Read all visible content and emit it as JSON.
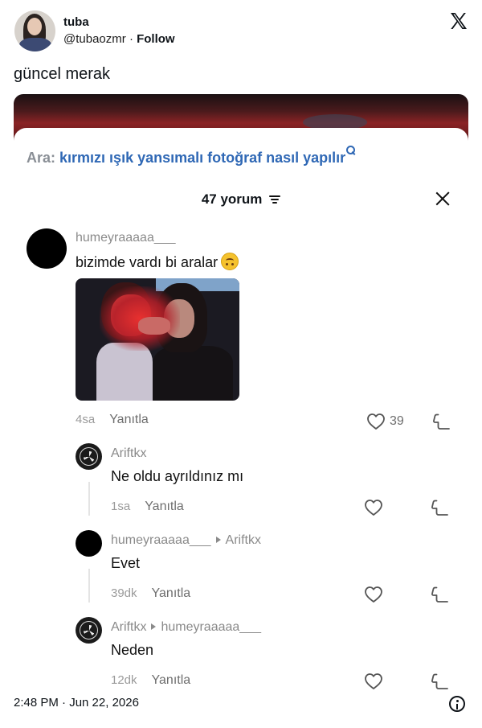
{
  "tweet": {
    "author_name": "tuba",
    "handle": "@tubaozmr",
    "separator": "·",
    "follow_label": "Follow",
    "text": "güncel merak",
    "timestamp": "2:48 PM · Jun 22, 2026"
  },
  "screenshot": {
    "search_prefix": "Ara:",
    "search_query": "kırmızı ışık yansımalı fotoğraf nasıl yapılır",
    "comments_count_label": "47 yorum",
    "comments": [
      {
        "user": "humeyraaaaa___",
        "text": "bizimde vardı bi aralar",
        "emoji": "upside-down-face",
        "time": "4sa",
        "reply_label": "Yanıtla",
        "likes": "39"
      }
    ],
    "replies": [
      {
        "user": "Ariftkx",
        "reply_to": "",
        "text": "Ne oldu ayrıldınız mı",
        "time": "1sa",
        "reply_label": "Yanıtla"
      },
      {
        "user": "humeyraaaaa___",
        "reply_to": "Ariftkx",
        "text": "Evet",
        "time": "39dk",
        "reply_label": "Yanıtla"
      },
      {
        "user": "Ariftkx",
        "reply_to": "humeyraaaaa___",
        "text": "Neden",
        "time": "12dk",
        "reply_label": "Yanıtla"
      }
    ]
  },
  "icons": {
    "brand": "x-logo-icon",
    "search": "search-icon",
    "sort": "sort-icon",
    "close": "close-icon",
    "like": "heart-icon",
    "dislike": "dislike-icon",
    "info": "info-icon"
  },
  "colors": {
    "search_query": "#2f68b5",
    "username": "#8a8a8a",
    "text": "#0f1419"
  }
}
